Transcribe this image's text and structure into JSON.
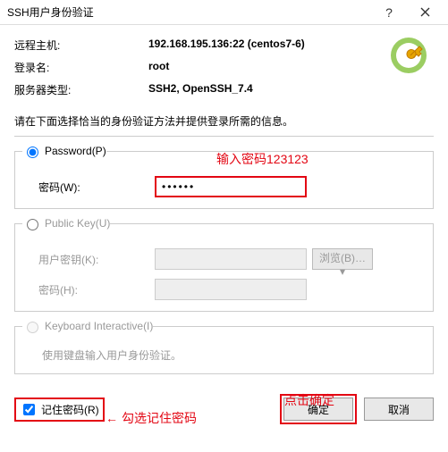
{
  "titlebar": {
    "title": "SSH用户身份验证"
  },
  "info": {
    "remote_host_label": "远程主机:",
    "remote_host_value": "192.168.195.136:22 (centos7-6)",
    "login_label": "登录名:",
    "login_value": "root",
    "server_type_label": "服务器类型:",
    "server_type_value": "SSH2, OpenSSH_7.4"
  },
  "instruction": "请在下面选择恰当的身份验证方法并提供登录所需的信息。",
  "password_group": {
    "radio_label": "Password(P)",
    "pw_label": "密码(W):",
    "pw_value": "••••••"
  },
  "publickey_group": {
    "radio_label": "Public Key(U)",
    "userkey_label": "用户密钥(K):",
    "browse_label": "浏览(B)…",
    "pw_label": "密码(H):"
  },
  "keyboard_group": {
    "radio_label": "Keyboard Interactive(I)",
    "hint": "使用键盘输入用户身份验证。"
  },
  "footer": {
    "remember_label": "记住密码(R)",
    "ok_label": "确定",
    "cancel_label": "取消"
  },
  "annotations": {
    "pw_hint": "输入密码123123",
    "remember_hint": "勾选记住密码",
    "ok_hint": "点击确定"
  }
}
